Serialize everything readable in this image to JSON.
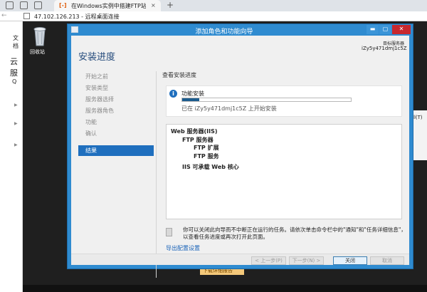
{
  "browser": {
    "tab_title": "在Windows实例中搭建FTP站点 -",
    "tab_close": "×",
    "new_tab": "+",
    "address": "47.102.126.213 - 远程桌面连接",
    "back": "←"
  },
  "web_page": {
    "text1": "文档",
    "text2": "云服",
    "text3": "Q"
  },
  "desktop": {
    "recycle_bin_label": "回收站",
    "right_panel_text": "ll(T)",
    "orange_button": "下载详细报告"
  },
  "dialog": {
    "title": "添加角色和功能向导",
    "minimize": "▬",
    "maximize": "▢",
    "close": "✕",
    "heading": "安装进度",
    "target_server_label": "目标服务器",
    "target_server_name": "iZy5y471dmj1c5Z",
    "steps": [
      {
        "label": "开始之前"
      },
      {
        "label": "安装类型"
      },
      {
        "label": "服务器选择"
      },
      {
        "label": "服务器角色"
      },
      {
        "label": "功能"
      },
      {
        "label": "确认"
      },
      {
        "label": "结果"
      }
    ],
    "active_step": 6,
    "section_label": "查看安装进度",
    "info": {
      "icon": "i",
      "label": "功能安装",
      "progress": 0.1,
      "status": "已在 iZy5y471dmj1c5Z 上开始安装"
    },
    "features": [
      {
        "label": "Web 服务器(IIS)",
        "level": 0
      },
      {
        "label": "FTP 服务器",
        "level": 1
      },
      {
        "label": "FTP 扩展",
        "level": 2
      },
      {
        "label": "FTP 服务",
        "level": 2
      },
      {
        "label": "IIS 可承载 Web 核心",
        "level": 1
      }
    ],
    "note": "你可以关闭此向导而不中断正在运行的任务。请依次单击命令栏中的\"通知\"和\"任务详细信息\"，以查看任务进度或再次打开此页面。",
    "export_link": "导出配置设置",
    "buttons": {
      "prev": "< 上一步(P)",
      "next": "下一步(N) >",
      "close": "关闭",
      "cancel": "取消"
    }
  }
}
